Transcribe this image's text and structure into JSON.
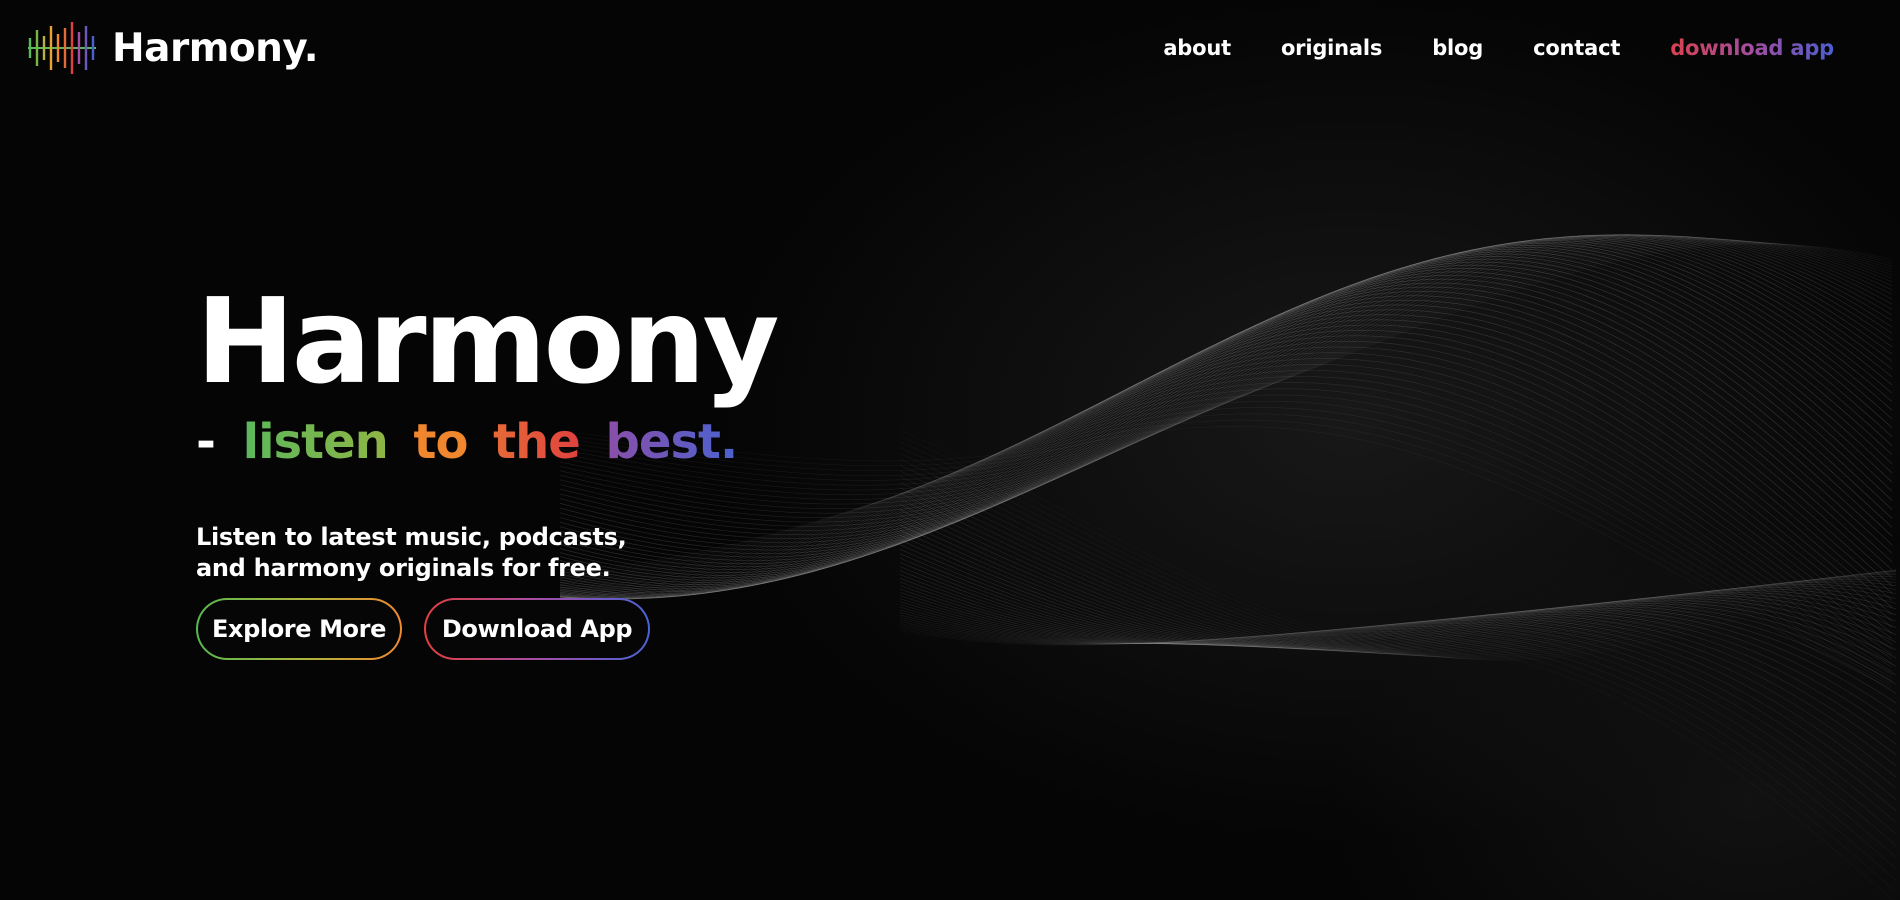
{
  "header": {
    "brand_name": "Harmony.",
    "brand_icon": "sound-wave-logo-icon"
  },
  "nav": {
    "items": [
      {
        "label": "about"
      },
      {
        "label": "originals"
      },
      {
        "label": "blog"
      },
      {
        "label": "contact"
      },
      {
        "label": "download app"
      }
    ]
  },
  "hero": {
    "title": "Harmony",
    "tagline": {
      "dash": "-",
      "word1": "listen",
      "word2": "to",
      "word3": "the",
      "word4": "best."
    },
    "description": "Listen to latest music, podcasts, and harmony originals for free.",
    "buttons": {
      "explore": "Explore More",
      "download": "Download App"
    }
  },
  "colors": {
    "background": "#050505",
    "green": "#5cb85c",
    "orange": "#f0862e",
    "red": "#e0413f",
    "purple": "#8a4fa8",
    "blue": "#4a62d0"
  }
}
